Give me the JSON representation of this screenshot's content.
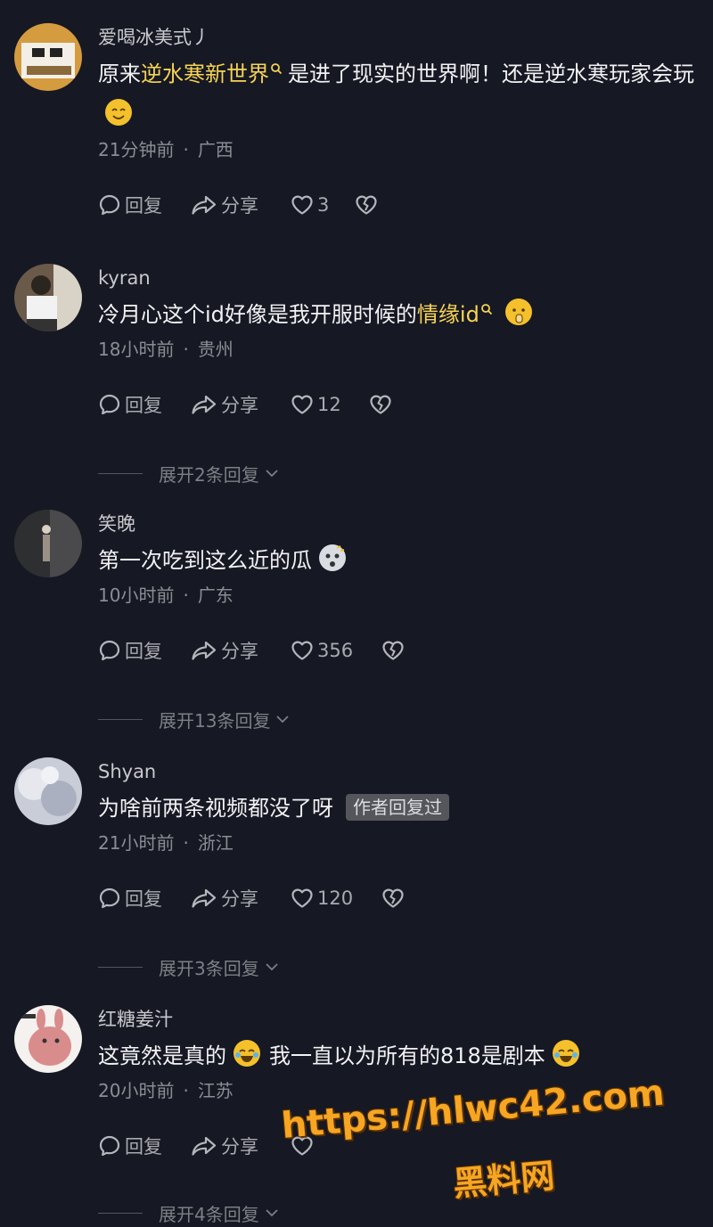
{
  "comments": [
    {
      "username": "爱喝冰美式丿",
      "text_before": "原来",
      "link": "逆水寒新世界",
      "text_after": "是进了现实的世界啊！还是逆水寒玩家会玩",
      "time": "21分钟前",
      "location": "广西",
      "reply_label": "回复",
      "share_label": "分享",
      "likes": "3"
    },
    {
      "username": "kyran",
      "text_before": "冷月心这个id好像是我开服时候的",
      "link": "情缘id",
      "text_after": "",
      "time": "18小时前",
      "location": "贵州",
      "reply_label": "回复",
      "share_label": "分享",
      "likes": "12",
      "expand": "展开2条回复"
    },
    {
      "username": "笑晚",
      "text_before": "第一次吃到这么近的瓜",
      "time": "10小时前",
      "location": "广东",
      "reply_label": "回复",
      "share_label": "分享",
      "likes": "356",
      "expand": "展开13条回复"
    },
    {
      "username": "Shyan",
      "text_before": "为啥前两条视频都没了呀",
      "badge": "作者回复过",
      "time": "21小时前",
      "location": "浙江",
      "reply_label": "回复",
      "share_label": "分享",
      "likes": "120",
      "expand": "展开3条回复"
    },
    {
      "username": "红糖姜汁",
      "text_before": "这竟然是真的",
      "text_mid": "我一直以为所有的818是剧本",
      "time": "20小时前",
      "location": "江苏",
      "reply_label": "回复",
      "share_label": "分享",
      "expand": "展开4条回复"
    }
  ],
  "watermark": {
    "url": "https://hlwc42.com",
    "name": "黑料网"
  },
  "colors": {
    "background": "#161823",
    "link": "#f7d454",
    "watermark": "#f6a623"
  }
}
